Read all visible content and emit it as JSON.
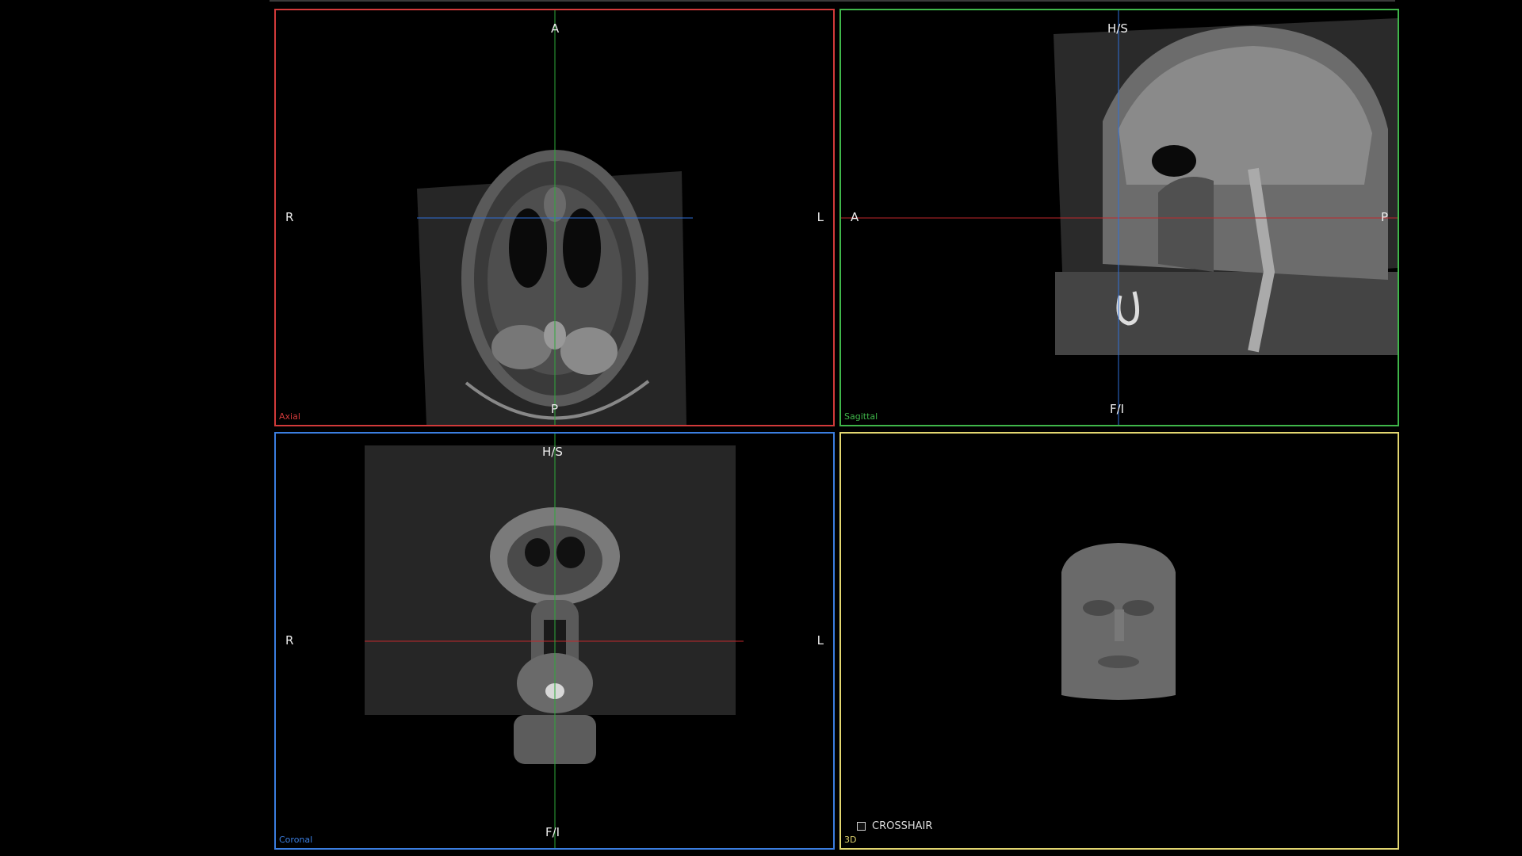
{
  "views": {
    "axial": {
      "label": "Axial",
      "top": "A",
      "bottom": "P",
      "left": "R",
      "right": "L",
      "color": "#d23a3a"
    },
    "sagittal": {
      "label": "Sagittal",
      "top": "H/S",
      "bottom": "F/I",
      "left": "A",
      "right": "P",
      "color": "#3fb64a"
    },
    "coronal": {
      "label": "Coronal",
      "top": "H/S",
      "bottom": "F/I",
      "left": "R",
      "right": "L",
      "color": "#3b7ee0"
    },
    "view3d": {
      "label": "3D",
      "color": "#e2d670"
    }
  },
  "crosshair_toggle": {
    "label": "CROSSHAIR",
    "checked": false
  },
  "colors": {
    "crosshair_red": "#c0282c",
    "crosshair_green": "#2ea83a",
    "crosshair_blue": "#2f6fd8"
  }
}
